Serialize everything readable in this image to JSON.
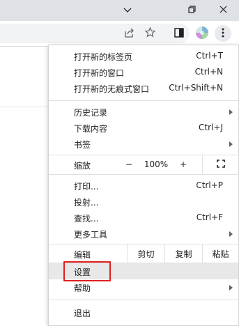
{
  "window": {
    "minimize_icon": "chevron-down-icon",
    "restore_icon": "restore-icon",
    "close_icon": "close-icon"
  },
  "toolbar": {
    "share_icon": "share-icon",
    "bookmark_icon": "star-icon",
    "side_panel_icon": "side-panel-icon",
    "profile_icon": "avatar-icon",
    "menu_icon": "kebab-menu-icon"
  },
  "menu": {
    "new_tab": {
      "label": "打开新的标签页",
      "shortcut": "Ctrl+T"
    },
    "new_window": {
      "label": "打开新的窗口",
      "shortcut": "Ctrl+N"
    },
    "incognito": {
      "label": "打开新的无痕式窗口",
      "shortcut": "Ctrl+Shift+N"
    },
    "history": {
      "label": "历史记录"
    },
    "downloads": {
      "label": "下载内容",
      "shortcut": "Ctrl+J"
    },
    "bookmarks": {
      "label": "书签"
    },
    "zoom": {
      "label": "缩放",
      "minus": "−",
      "value": "100%",
      "plus": "+"
    },
    "print": {
      "label": "打印...",
      "shortcut": "Ctrl+P"
    },
    "cast": {
      "label": "投射..."
    },
    "find": {
      "label": "查找...",
      "shortcut": "Ctrl+F"
    },
    "more_tools": {
      "label": "更多工具"
    },
    "edit": {
      "label": "编辑",
      "cut": "剪切",
      "copy": "复制",
      "paste": "粘贴"
    },
    "settings": {
      "label": "设置"
    },
    "help": {
      "label": "帮助"
    },
    "exit": {
      "label": "退出"
    }
  },
  "colors": {
    "highlight_border": "#e02020",
    "hover_bg": "#e8e8e8"
  }
}
